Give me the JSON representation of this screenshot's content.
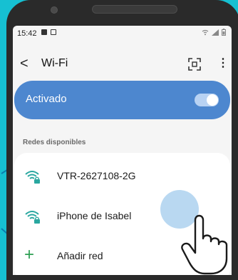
{
  "status_bar": {
    "time": "15:42"
  },
  "app_bar": {
    "back_label": "<",
    "title": "Wi-Fi",
    "more_label": "⋮"
  },
  "wifi_toggle": {
    "label": "Activado",
    "state": "on"
  },
  "networks": {
    "section_title": "Redes disponibles",
    "items": [
      {
        "name": "VTR-2627108-2G",
        "icon": "wifi-lock-icon"
      },
      {
        "name": "iPhone de Isabel",
        "icon": "wifi-lock-icon"
      }
    ],
    "add_label": "Añadir red",
    "add_icon": "plus-icon"
  },
  "colors": {
    "background": "#16c0d2",
    "toggle_bar": "#4d87cf",
    "wifi_icon": "#2aa7a0",
    "add_icon": "#2d9f53",
    "tap_highlight": "#b5d6f0"
  }
}
